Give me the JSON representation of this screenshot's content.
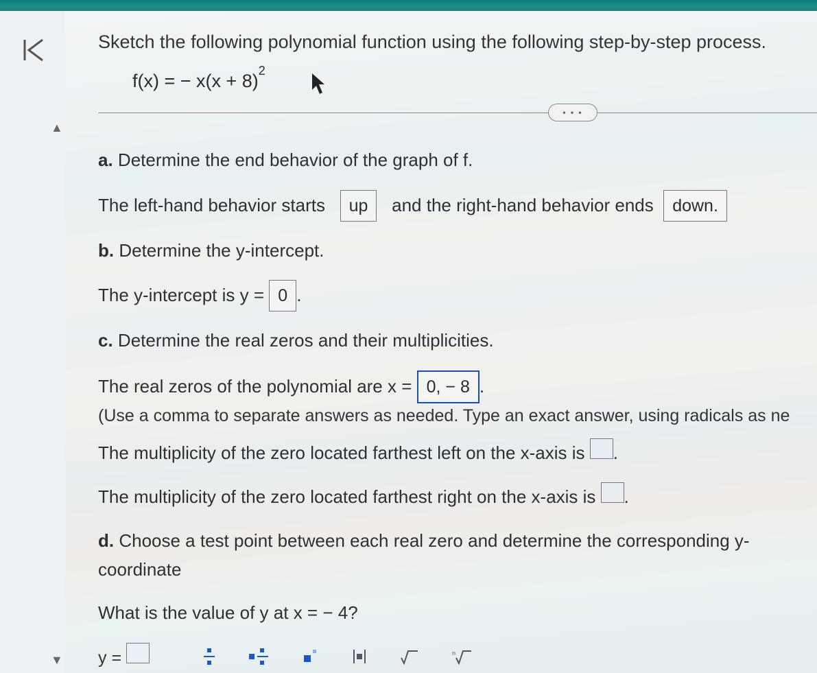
{
  "problem": {
    "title": "Sketch the following polynomial function using the following step-by-step process.",
    "equation_display": "f(x) = − x(x + 8)",
    "equation_exp": "2"
  },
  "parts": {
    "a": {
      "prompt": "Determine the end behavior of the graph of f.",
      "sentence_pre": "The left-hand behavior starts",
      "ans_left": "up",
      "sentence_mid": "and the right-hand behavior ends",
      "ans_right": "down."
    },
    "b": {
      "prompt": "Determine the y-intercept.",
      "sentence": "The y-intercept is y =",
      "ans": "0",
      "after": "."
    },
    "c": {
      "prompt": "Determine the real zeros and their multiplicities.",
      "zeros_pre": "The real zeros of the polynomial are x =",
      "zeros_ans": "0, − 8",
      "zeros_after": ".",
      "hint": "(Use a comma to separate answers as needed. Type an exact answer, using radicals as ne",
      "mult_left_pre": "The multiplicity of the zero located farthest left on the x-axis is",
      "mult_left_after": ".",
      "mult_right_pre": "The multiplicity of the zero located farthest right on the x-axis is",
      "mult_right_after": "."
    },
    "d": {
      "prompt": "Choose a test point between each real zero and determine the corresponding y-coordinate",
      "question": "What is the value of y at x = − 4?",
      "y_eq": "y ="
    }
  },
  "ui": {
    "more": "• • •"
  }
}
